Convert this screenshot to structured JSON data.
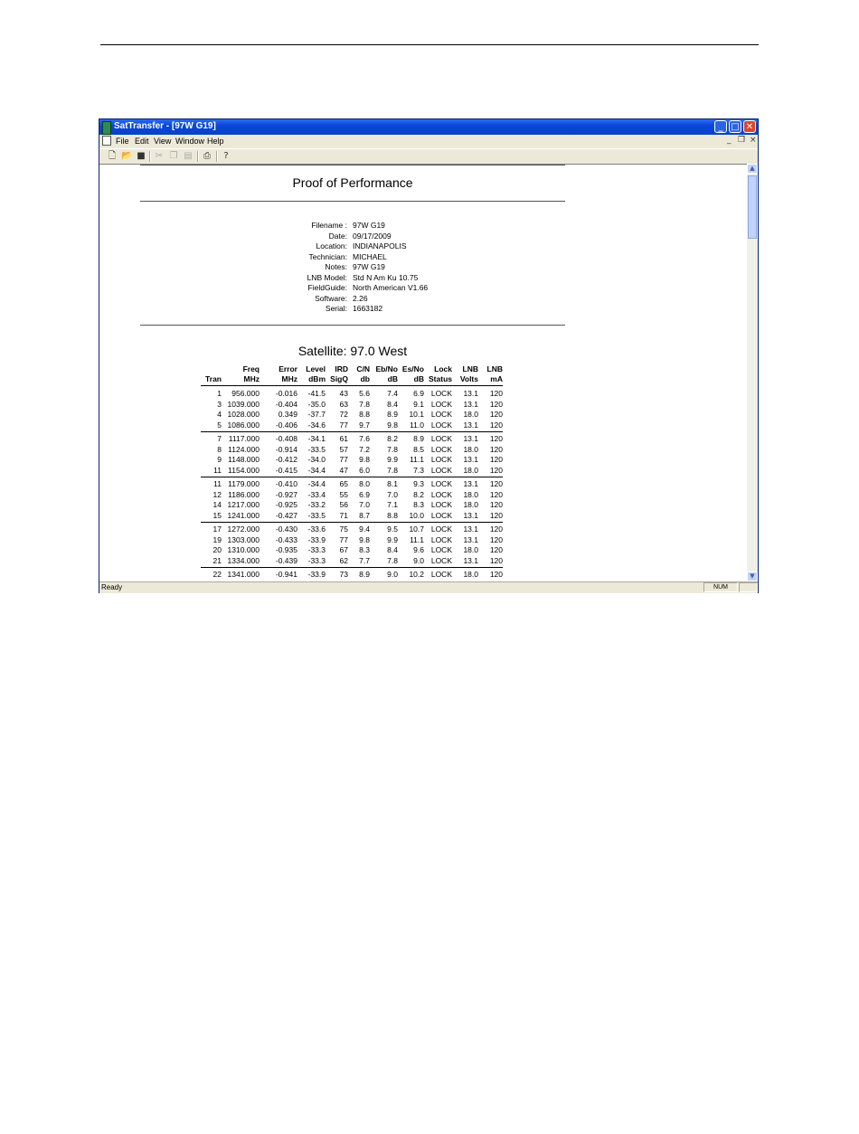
{
  "window": {
    "title": "SatTransfer - [97W G19]",
    "controls": {
      "minimize": "_",
      "maximize": "□",
      "close": "✕"
    }
  },
  "menu": {
    "items": [
      "File",
      "Edit",
      "View",
      "Window",
      "Help"
    ],
    "mdi_controls": {
      "minimize": "_",
      "restore": "❐",
      "close": "×"
    }
  },
  "toolbar": {
    "icons": [
      "new-icon",
      "open-icon",
      "save-icon",
      "cut-icon",
      "copy-icon",
      "paste-icon",
      "print-icon",
      "help-icon"
    ]
  },
  "report": {
    "title": "Proof of Performance",
    "info": [
      {
        "label": "Filename :",
        "value": "97W G19"
      },
      {
        "label": "Date:",
        "value": "09/17/2009"
      },
      {
        "label": "Location:",
        "value": "INDIANAPOLIS"
      },
      {
        "label": "Technician:",
        "value": "MICHAEL"
      },
      {
        "label": "Notes:",
        "value": "97W G19"
      },
      {
        "label": "LNB Model:",
        "value": "Std N Am Ku 10.75"
      },
      {
        "label": "FieldGuide:",
        "value": "North American V1.66"
      },
      {
        "label": "Software:",
        "value": "2.26"
      },
      {
        "label": "Serial:",
        "value": "1663182"
      }
    ],
    "satellite": "Satellite: 97.0 West",
    "columns": [
      {
        "top": "",
        "bottom": "Tran"
      },
      {
        "top": "Freq",
        "bottom": "MHz"
      },
      {
        "top": "Error",
        "bottom": "MHz"
      },
      {
        "top": "Level",
        "bottom": "dBm"
      },
      {
        "top": "IRD",
        "bottom": "SigQ"
      },
      {
        "top": "C/N",
        "bottom": "db"
      },
      {
        "top": "Eb/No",
        "bottom": "dB"
      },
      {
        "top": "Es/No",
        "bottom": "dB"
      },
      {
        "top": "Lock",
        "bottom": "Status"
      },
      {
        "top": "LNB",
        "bottom": "Volts"
      },
      {
        "top": "LNB",
        "bottom": "mA"
      }
    ],
    "groups": [
      [
        [
          "1",
          "956.000",
          "-0.016",
          "-41.5",
          "43",
          "5.6",
          "7.4",
          "6.9",
          "LOCK",
          "13.1",
          "120"
        ],
        [
          "3",
          "1039.000",
          "-0.404",
          "-35.0",
          "63",
          "7.8",
          "8.4",
          "9.1",
          "LOCK",
          "13.1",
          "120"
        ],
        [
          "4",
          "1028.000",
          "0.349",
          "-37.7",
          "72",
          "8.8",
          "8.9",
          "10.1",
          "LOCK",
          "18.0",
          "120"
        ],
        [
          "5",
          "1086.000",
          "-0.406",
          "-34.6",
          "77",
          "9.7",
          "9.8",
          "11.0",
          "LOCK",
          "13.1",
          "120"
        ]
      ],
      [
        [
          "7",
          "1117.000",
          "-0.408",
          "-34.1",
          "61",
          "7.6",
          "8.2",
          "8.9",
          "LOCK",
          "13.1",
          "120"
        ],
        [
          "8",
          "1124.000",
          "-0.914",
          "-33.5",
          "57",
          "7.2",
          "7.8",
          "8.5",
          "LOCK",
          "18.0",
          "120"
        ],
        [
          "9",
          "1148.000",
          "-0.412",
          "-34.0",
          "77",
          "9.8",
          "9.9",
          "11.1",
          "LOCK",
          "13.1",
          "120"
        ],
        [
          "11",
          "1154.000",
          "-0.415",
          "-34.4",
          "47",
          "6.0",
          "7.8",
          "7.3",
          "LOCK",
          "18.0",
          "120"
        ]
      ],
      [
        [
          "11",
          "1179.000",
          "-0.410",
          "-34.4",
          "65",
          "8.0",
          "8.1",
          "9.3",
          "LOCK",
          "13.1",
          "120"
        ],
        [
          "12",
          "1186.000",
          "-0.927",
          "-33.4",
          "55",
          "6.9",
          "7.0",
          "8.2",
          "LOCK",
          "18.0",
          "120"
        ],
        [
          "14",
          "1217.000",
          "-0.925",
          "-33.2",
          "56",
          "7.0",
          "7.1",
          "8.3",
          "LOCK",
          "18.0",
          "120"
        ],
        [
          "15",
          "1241.000",
          "-0.427",
          "-33.5",
          "71",
          "8.7",
          "8.8",
          "10.0",
          "LOCK",
          "13.1",
          "120"
        ]
      ],
      [
        [
          "17",
          "1272.000",
          "-0.430",
          "-33.6",
          "75",
          "9.4",
          "9.5",
          "10.7",
          "LOCK",
          "13.1",
          "120"
        ],
        [
          "19",
          "1303.000",
          "-0.433",
          "-33.9",
          "77",
          "9.8",
          "9.9",
          "11.1",
          "LOCK",
          "13.1",
          "120"
        ],
        [
          "20",
          "1310.000",
          "-0.935",
          "-33.3",
          "67",
          "8.3",
          "8.4",
          "9.6",
          "LOCK",
          "18.0",
          "120"
        ],
        [
          "21",
          "1334.000",
          "-0.439",
          "-33.3",
          "62",
          "7.7",
          "7.8",
          "9.0",
          "LOCK",
          "13.1",
          "120"
        ]
      ],
      [
        [
          "22",
          "1341.000",
          "-0.941",
          "-33.9",
          "73",
          "8.9",
          "9.0",
          "10.2",
          "LOCK",
          "18.0",
          "120"
        ]
      ]
    ]
  },
  "status": {
    "text": "Ready",
    "num": "NUM"
  }
}
